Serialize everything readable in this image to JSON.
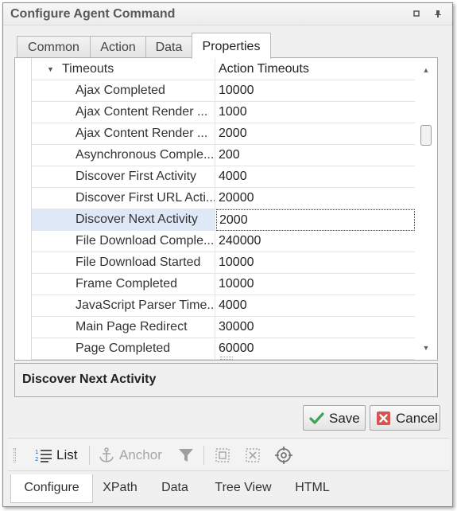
{
  "window": {
    "title": "Configure Agent Command"
  },
  "tabs": [
    {
      "label": "Common"
    },
    {
      "label": "Action"
    },
    {
      "label": "Data"
    },
    {
      "label": "Properties",
      "active": true
    }
  ],
  "property_grid": {
    "group": {
      "name": "Timeouts",
      "value": "Action Timeouts"
    },
    "rows": [
      {
        "name": "Ajax Completed",
        "value": "10000"
      },
      {
        "name": "Ajax Content Render ...",
        "value": "1000"
      },
      {
        "name": "Ajax Content Render ...",
        "value": "2000"
      },
      {
        "name": "Asynchronous Comple...",
        "value": "200"
      },
      {
        "name": "Discover First Activity",
        "value": "4000"
      },
      {
        "name": "Discover First URL Acti...",
        "value": "20000"
      },
      {
        "name": "Discover Next Activity",
        "value": "2000",
        "selected": true
      },
      {
        "name": "File Download Comple...",
        "value": "240000"
      },
      {
        "name": "File Download Started",
        "value": "10000"
      },
      {
        "name": "Frame Completed",
        "value": "10000"
      },
      {
        "name": "JavaScript Parser Time...",
        "value": "4000"
      },
      {
        "name": "Main Page Redirect",
        "value": "30000"
      },
      {
        "name": "Page Completed",
        "value": "60000"
      }
    ]
  },
  "description": {
    "title": "Discover Next Activity"
  },
  "buttons": {
    "save": "Save",
    "cancel": "Cancel"
  },
  "toolbar": {
    "list": "List",
    "anchor": "Anchor"
  },
  "bottom_tabs": [
    {
      "label": "Configure",
      "active": true
    },
    {
      "label": "XPath"
    },
    {
      "label": "Data"
    },
    {
      "label": "Tree View"
    },
    {
      "label": "HTML"
    }
  ],
  "colors": {
    "save_check": "#3aa655",
    "cancel_x": "#d9534f",
    "selection": "#dfe8f7"
  }
}
